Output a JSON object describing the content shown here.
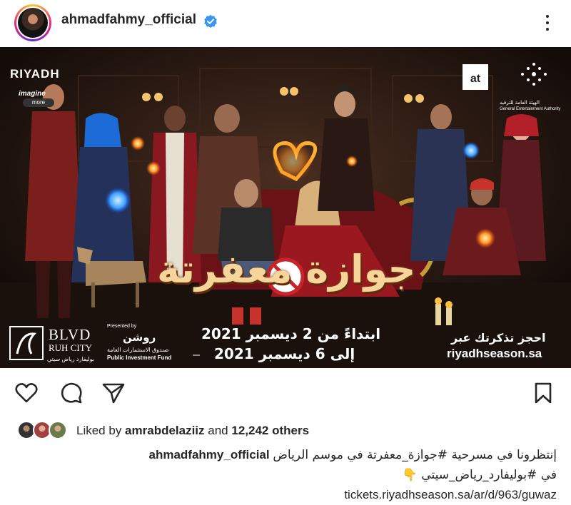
{
  "header": {
    "username": "ahmadfahmy_official",
    "verified_icon": "verified-badge-icon",
    "more_icon": "more-options-icon"
  },
  "poster": {
    "riyadh_logo": "RIYADH",
    "imagine": "imagine",
    "more_pill": "more",
    "title_ar": "جوازة معفرتة",
    "date_line1": "ابتداءً من 2 ديسمبر 2021",
    "date_line2": "إلى 6 ديسمبر 2021",
    "book_ar": "احجز تذكرتك عبر",
    "book_url": "riyadhseason.sa",
    "blvd": "BLVD",
    "ruh_city": "RUH CITY",
    "blvd_ar": "بوليفارد رياض سيتي",
    "presented_by": "Presented by",
    "roshn": "روشن",
    "pif_ar": "صندوق الاستثمارات العامة",
    "pif_en": "Public Investment Fund",
    "gea_ar": "الهيئة العامة للترفيه",
    "gea_en": "General Entertainment Authority"
  },
  "actions": {
    "like_icon": "heart-icon",
    "comment_icon": "comment-icon",
    "share_icon": "send-icon",
    "save_icon": "bookmark-icon"
  },
  "likes": {
    "prefix": "Liked by ",
    "user": "amrabdelaziiz",
    "middle": " and ",
    "count": "12,242 others"
  },
  "caption": {
    "username": "ahmadfahmy_official",
    "line1": "إنتظرونا في مسرحية #جوازة_معفرتة في موسم الرياض",
    "line2": "في #بوليفارد_رياض_سيتي 👇",
    "link": "tickets.riyadhseason.sa/ar/d/963/guwaz"
  },
  "colors": {
    "verified": "#3897f0",
    "text": "#262626",
    "poster_title": "#f6d59a"
  }
}
